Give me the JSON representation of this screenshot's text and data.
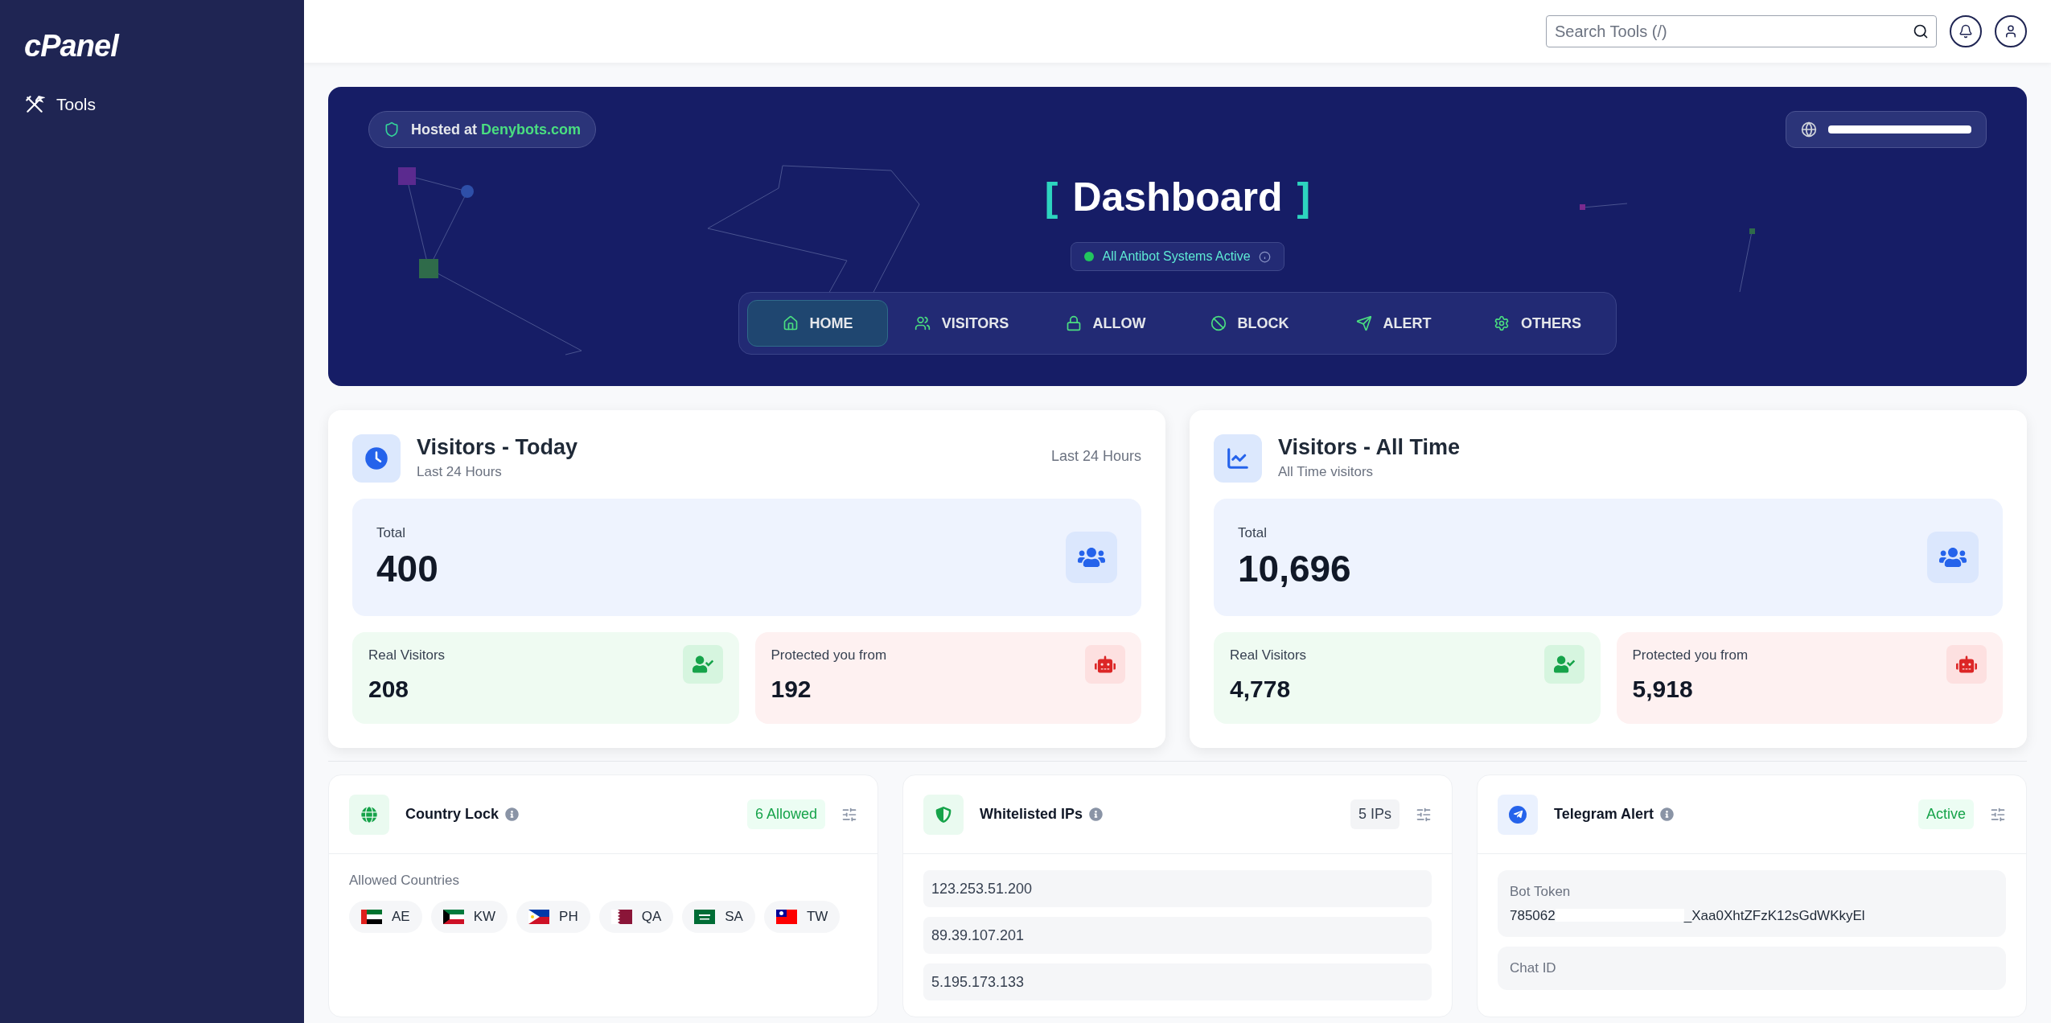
{
  "sidebar": {
    "logo": "cPanel",
    "items": [
      {
        "label": "Tools"
      }
    ]
  },
  "header": {
    "search": {
      "placeholder": "Search Tools (/)"
    }
  },
  "banner": {
    "hosted_prefix": "Hosted at",
    "hosted_link": "Denybots.com",
    "title_open": "[",
    "title": "Dashboard",
    "title_close": "]",
    "status": "All Antibot Systems Active",
    "nav": [
      {
        "label": "HOME",
        "selected": true
      },
      {
        "label": "VISITORS",
        "selected": false
      },
      {
        "label": "ALLOW",
        "selected": false
      },
      {
        "label": "BLOCK",
        "selected": false
      },
      {
        "label": "ALERT",
        "selected": false
      },
      {
        "label": "OTHERS",
        "selected": false
      }
    ]
  },
  "stats": [
    {
      "title": "Visitors - Today",
      "subtitle": "Last 24 Hours",
      "aside": "Last 24 Hours",
      "total_label": "Total",
      "total": "400",
      "parts": [
        {
          "kind": "real",
          "label": "Real Visitors",
          "value": "208"
        },
        {
          "kind": "bots",
          "label": "Protected you from",
          "value": "192"
        }
      ]
    },
    {
      "title": "Visitors - All Time",
      "subtitle": "All Time visitors",
      "total_label": "Total",
      "total": "10,696",
      "parts": [
        {
          "kind": "real",
          "label": "Real Visitors",
          "value": "4,778"
        },
        {
          "kind": "bots",
          "label": "Protected you from",
          "value": "5,918"
        }
      ]
    }
  ],
  "panels": [
    {
      "kind": "countries",
      "title": "Country Lock",
      "badge": {
        "text": "6 Allowed",
        "kind": "success"
      },
      "section_label": "Allowed Countries",
      "countries": [
        "AE",
        "KW",
        "PH",
        "QA",
        "SA",
        "TW"
      ]
    },
    {
      "kind": "ips",
      "title": "Whitelisted IPs",
      "badge": {
        "text": "5 IPs",
        "kind": "neutral"
      },
      "ips": [
        "123.253.51.200",
        "89.39.107.201",
        "5.195.173.133"
      ]
    },
    {
      "kind": "telegram",
      "title": "Telegram Alert",
      "badge": {
        "text": "Active",
        "kind": "success"
      },
      "fields": [
        {
          "label": "Bot Token",
          "value_start": "785062",
          "value_end": "_Xaa0XhtZFzK12sGdWKkyEl"
        },
        {
          "label": "Chat ID"
        }
      ]
    }
  ]
}
